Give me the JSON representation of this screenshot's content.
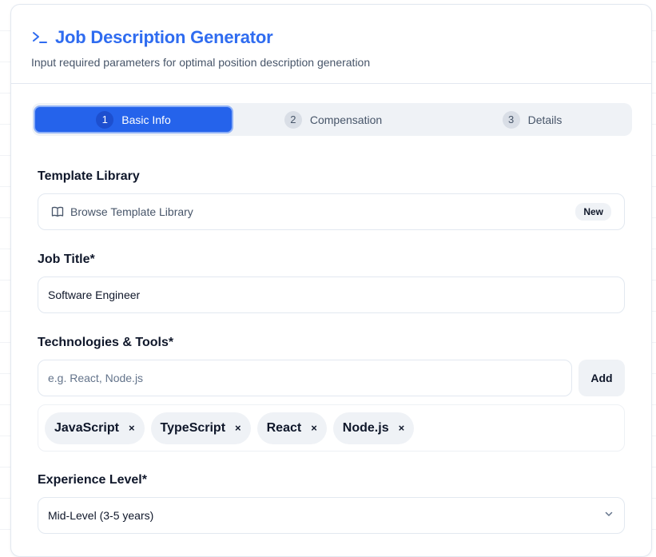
{
  "header": {
    "title": "Job Description Generator",
    "subtitle": "Input required parameters for optimal position description generation",
    "icon": "terminal-icon"
  },
  "steps": [
    {
      "num": "1",
      "label": "Basic Info",
      "active": true
    },
    {
      "num": "2",
      "label": "Compensation",
      "active": false
    },
    {
      "num": "3",
      "label": "Details",
      "active": false
    }
  ],
  "template": {
    "label": "Template Library",
    "button_text": "Browse Template Library",
    "badge": "New",
    "icon": "book-open-icon"
  },
  "job_title": {
    "label": "Job Title*",
    "value": "Software Engineer"
  },
  "technologies": {
    "label": "Technologies & Tools*",
    "placeholder": "e.g. React, Node.js",
    "add_label": "Add",
    "tags": [
      "JavaScript",
      "TypeScript",
      "React",
      "Node.js"
    ],
    "remove_symbol": "×"
  },
  "experience": {
    "label": "Experience Level*",
    "value": "Mid-Level (3-5 years)",
    "icon": "chevron-down-icon"
  },
  "colors": {
    "accent": "#2563eb",
    "title": "#2f6cf0",
    "muted_bg": "#eff2f6",
    "border": "#e2e8f0"
  }
}
